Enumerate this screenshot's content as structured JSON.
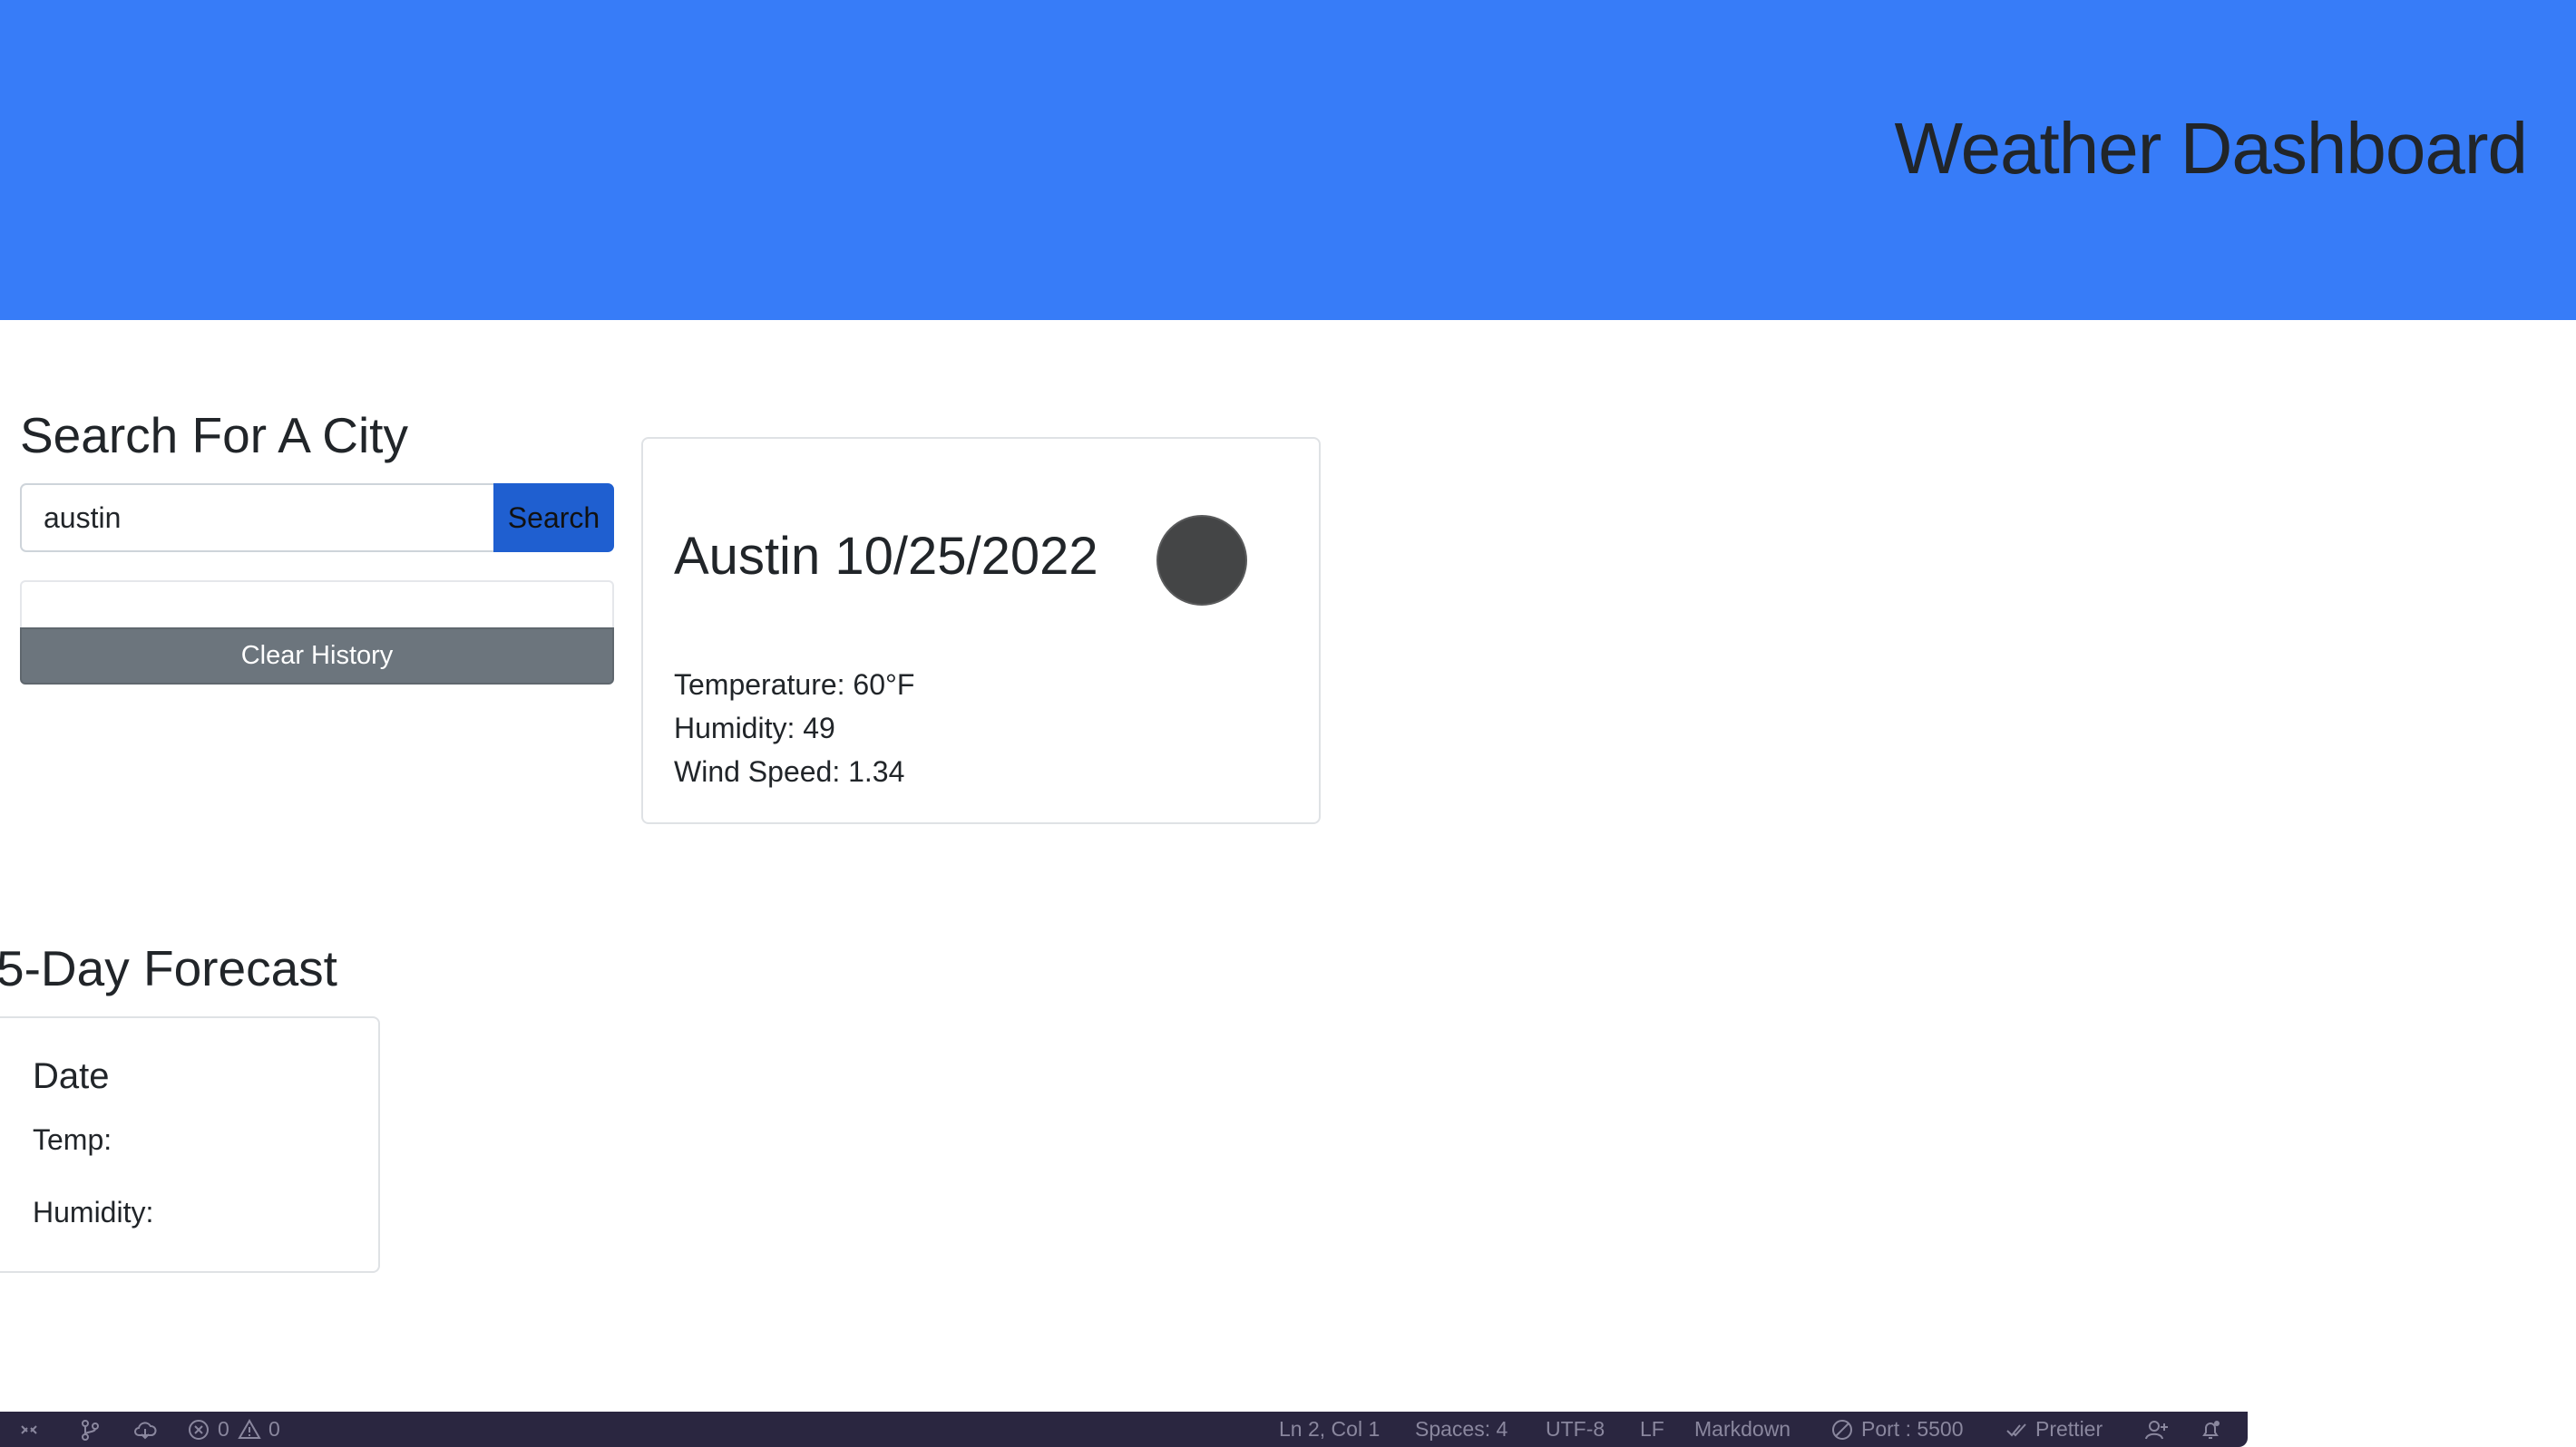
{
  "header": {
    "title": "Weather Dashboard"
  },
  "search": {
    "heading": "Search For A City",
    "input_value": "austin",
    "button_label": "Search",
    "clear_label": "Clear History"
  },
  "current": {
    "title": "Austin 10/25/2022",
    "temperature": "Temperature: 60°F",
    "humidity": "Humidity: 49",
    "wind": "Wind Speed: 1.34",
    "icon": "weather-icon"
  },
  "forecast": {
    "heading": "5-Day Forecast",
    "cards": [
      {
        "date": "Date",
        "temp": "Temp:",
        "humidity": "Humidity:"
      }
    ]
  },
  "statusbar": {
    "errors": "0",
    "warnings": "0",
    "position": "Ln 2, Col 1",
    "spaces": "Spaces: 4",
    "encoding": "UTF-8",
    "eol": "LF",
    "language": "Markdown",
    "port": "Port : 5500",
    "formatter": "Prettier",
    "icons": [
      "remote-icon",
      "branch-icon",
      "sync-icon",
      "error-icon",
      "warning-icon",
      "port-icon",
      "check-icon",
      "accounts-icon",
      "bell-icon"
    ]
  },
  "colors": {
    "header_bg": "#377cf8",
    "search_button": "#1f5fd0",
    "clear_button": "#6c757d",
    "statusbar_bg": "#2a2640"
  }
}
